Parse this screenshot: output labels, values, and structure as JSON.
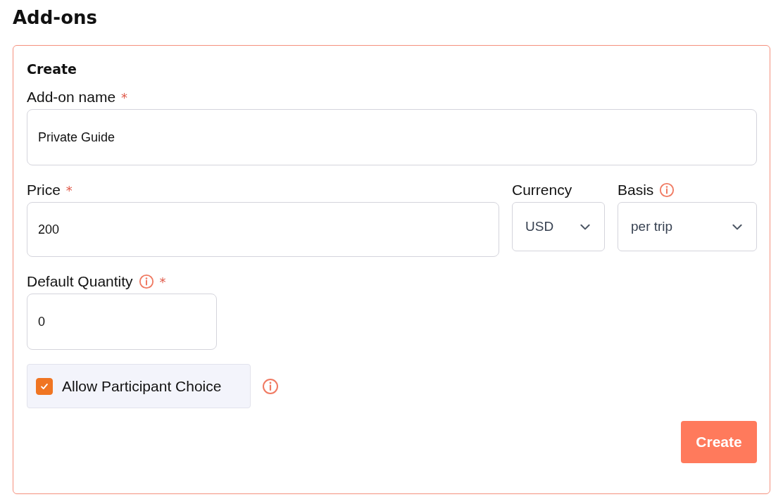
{
  "page_title": "Add-ons",
  "form": {
    "title": "Create",
    "rows": [
      {
        "fields": [
          {
            "kind": "text",
            "label": "Add-on name",
            "required_mark": "*",
            "info": false,
            "value": "Private Guide"
          }
        ]
      },
      {
        "fields": [
          {
            "kind": "text",
            "label": "Price",
            "required_mark": "*",
            "info": false,
            "value": "200"
          },
          {
            "kind": "select",
            "label": "Currency",
            "info": false,
            "value": "USD"
          },
          {
            "kind": "select",
            "label": "Basis",
            "info": true,
            "value": "per trip"
          }
        ]
      },
      {
        "fields": [
          {
            "kind": "text",
            "label": "Default Quantity",
            "required_mark": "*",
            "info": true,
            "value": "0"
          }
        ]
      }
    ],
    "checkbox": {
      "label": "Allow Participant Choice",
      "checked": true,
      "info": true
    },
    "submit": "Create"
  }
}
